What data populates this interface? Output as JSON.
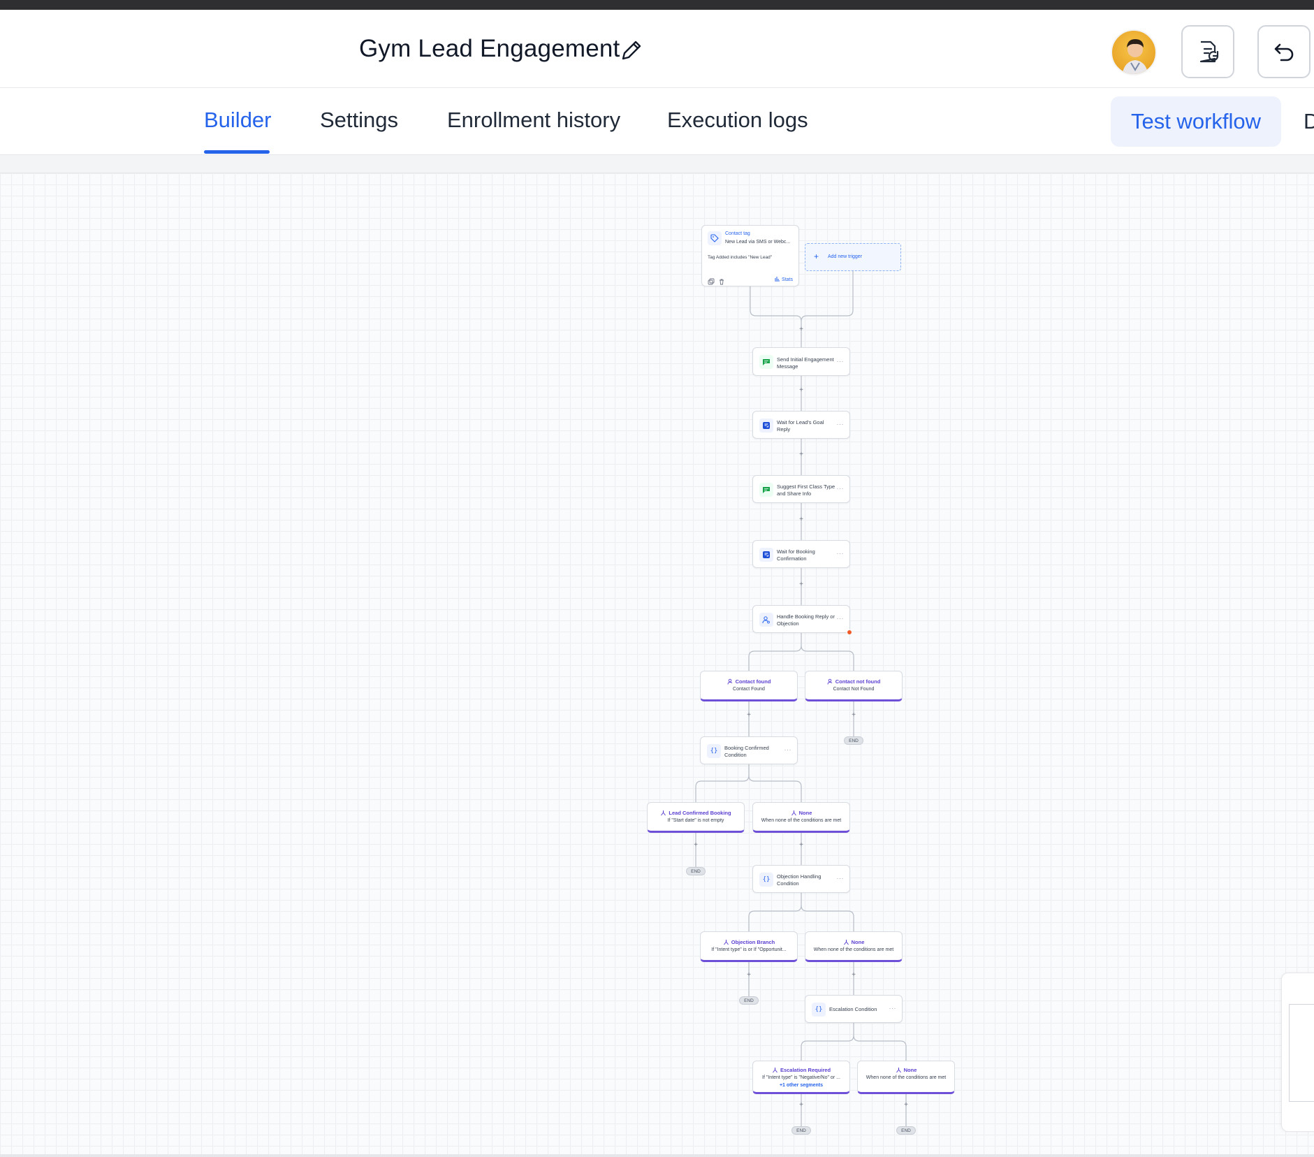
{
  "header": {
    "workflow_title": "Gym Lead Engagement"
  },
  "tabs": [
    {
      "label": "Builder",
      "active": true
    },
    {
      "label": "Settings",
      "active": false
    },
    {
      "label": "Enrollment history",
      "active": false
    },
    {
      "label": "Execution logs",
      "active": false
    }
  ],
  "test_workflow_label": "Test workflow",
  "truncated_tab_label": "D",
  "colors": {
    "accent": "#2563eb",
    "branch_accent": "#6d4fd8",
    "message_icon": "#16a34a",
    "error_dot": "#f05a28"
  },
  "trigger": {
    "type": "Contact tag",
    "name": "New Lead via SMS or Webc...",
    "filter": "Tag Added includes \"New Lead\"",
    "stats_label": "Stats"
  },
  "add_trigger_label": "Add new trigger",
  "steps": [
    {
      "icon": "message-icon",
      "label_1": "Send Initial Engagement",
      "label_2": "Message"
    },
    {
      "icon": "wait-reply-icon",
      "label_1": "Wait for Lead's Goal",
      "label_2": "Reply"
    },
    {
      "icon": "message-icon",
      "label_1": "Suggest First Class Type",
      "label_2": "and Share Info"
    },
    {
      "icon": "wait-reply-icon",
      "label_1": "Wait for Booking",
      "label_2": "Confirmation"
    },
    {
      "icon": "find-contact-icon",
      "label_1": "Handle Booking Reply or",
      "label_2": "Objection"
    }
  ],
  "contact_branches": [
    {
      "title": "Contact found",
      "desc": "Contact Found"
    },
    {
      "title": "Contact not found",
      "desc": "Contact Not Found"
    }
  ],
  "booking_condition": {
    "label_1": "Booking Confirmed",
    "label_2": "Condition"
  },
  "booking_branches": [
    {
      "title": "Lead Confirmed Booking",
      "desc": "If \"Start date\" is not empty"
    },
    {
      "title": "None",
      "desc": "When none of the conditions are met"
    }
  ],
  "objection_condition": {
    "label_1": "Objection Handling",
    "label_2": "Condition"
  },
  "objection_branches": [
    {
      "title": "Objection Branch",
      "desc": "If \"Intent type\" is or If \"Opportunit..."
    },
    {
      "title": "None",
      "desc": "When none of the conditions are met"
    }
  ],
  "escalation_condition": {
    "label": "Escalation Condition"
  },
  "escalation_branches": [
    {
      "title": "Escalation Required",
      "desc": "If \"Intent type\" is \"Negative/No\" or ...",
      "extra": "+1 other segments"
    },
    {
      "title": "None",
      "desc": "When none of the conditions are met"
    }
  ],
  "end_label": "END",
  "more_label": "···",
  "plus_label": "+"
}
